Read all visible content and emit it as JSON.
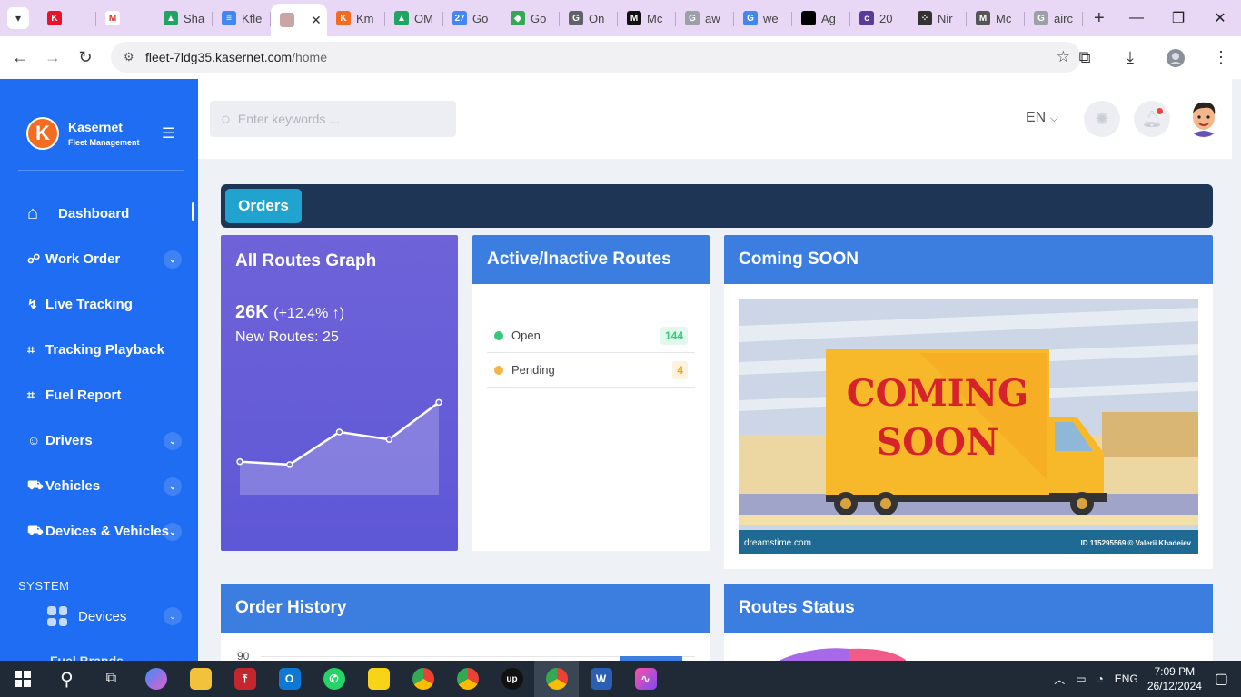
{
  "browser": {
    "tabs": [
      {
        "label": "",
        "fav_color": "#e8132b",
        "fav_text": "K"
      },
      {
        "label": "",
        "fav_color": "#ffffff",
        "fav_text": "M"
      },
      {
        "label": "Sha",
        "fav_color": "#1fa463",
        "fav_text": "▲"
      },
      {
        "label": "Kfle",
        "fav_color": "#4285f4",
        "fav_text": "≡"
      },
      {
        "label": "",
        "fav_color": "#c9a5a5",
        "fav_text": "",
        "active": true
      },
      {
        "label": "Km",
        "fav_color": "#f36c21",
        "fav_text": "K"
      },
      {
        "label": "OM",
        "fav_color": "#1fa463",
        "fav_text": "▲"
      },
      {
        "label": "Go",
        "fav_color": "#4285f4",
        "fav_text": "27"
      },
      {
        "label": "Go",
        "fav_color": "#34a853",
        "fav_text": "◆"
      },
      {
        "label": "On",
        "fav_color": "#5f6368",
        "fav_text": "G"
      },
      {
        "label": "Mc",
        "fav_color": "#111111",
        "fav_text": "M"
      },
      {
        "label": "aw",
        "fav_color": "#9aa0a6",
        "fav_text": "G"
      },
      {
        "label": "we",
        "fav_color": "#4285f4",
        "fav_text": "G"
      },
      {
        "label": "Ag",
        "fav_color": "#000000",
        "fav_text": ""
      },
      {
        "label": "20",
        "fav_color": "#5b3a99",
        "fav_text": "c"
      },
      {
        "label": "Nir",
        "fav_color": "#333333",
        "fav_text": "⁘"
      },
      {
        "label": "Mc",
        "fav_color": "#555555",
        "fav_text": "M"
      },
      {
        "label": "airc",
        "fav_color": "#9aa0a6",
        "fav_text": "G"
      }
    ],
    "url_host": "fleet-7ldg35.kasernet.com",
    "url_path": "/home"
  },
  "sidebar": {
    "brand_name": "Kasernet",
    "brand_sub": "Fleet Management",
    "brand_logo": "K",
    "items": [
      {
        "label": "Dashboard",
        "icon": "home-icon",
        "glyph": "⌂",
        "expandable": false,
        "active": true
      },
      {
        "label": "Work Order",
        "icon": "work-order-icon",
        "glyph": "☍",
        "expandable": true
      },
      {
        "label": "Live Tracking",
        "icon": "route-icon",
        "glyph": "↯",
        "expandable": false
      },
      {
        "label": "Tracking Playback",
        "icon": "playback-icon",
        "glyph": "⌗",
        "expandable": false
      },
      {
        "label": "Fuel Report",
        "icon": "fuel-report-icon",
        "glyph": "⌗",
        "expandable": false
      },
      {
        "label": "Drivers",
        "icon": "drivers-icon",
        "glyph": "☺",
        "expandable": true
      },
      {
        "label": "Vehicles",
        "icon": "vehicle-icon",
        "glyph": "⛟",
        "expandable": true
      },
      {
        "label": "Devices & Vehicles",
        "icon": "devices-vehicles-icon",
        "glyph": "⛟",
        "expandable": true
      }
    ],
    "system_label": "SYSTEM",
    "system_items": [
      {
        "label": "Devices",
        "icon": "grid-icon"
      }
    ],
    "cut_item": "Fuel Brands"
  },
  "header": {
    "search_placeholder": "Enter keywords ...",
    "language": "EN"
  },
  "toolbar": {
    "orders_label": "Orders"
  },
  "graph_card": {
    "title": "All Routes Graph",
    "value": "26K",
    "change": "(+12.4% ↑)",
    "sub": "New Routes: 25",
    "accent": "#6a60d9"
  },
  "chart_data": {
    "type": "area",
    "title": "All Routes Graph",
    "x": [
      1,
      2,
      3,
      4,
      5
    ],
    "series": [
      {
        "values": [
          10,
          8,
          30,
          25,
          50
        ]
      }
    ],
    "ylim": [
      0,
      60
    ],
    "grid": false
  },
  "routes_card": {
    "title": "Active/Inactive Routes",
    "rows": [
      {
        "label": "Open",
        "count": "144",
        "dot": "#34c97c",
        "badge_bg": "#e3f8ec",
        "badge_fg": "#34c97c"
      },
      {
        "label": "Pending",
        "count": "4",
        "dot": "#f5b544",
        "badge_bg": "#fdf2df",
        "badge_fg": "#f5a623"
      }
    ]
  },
  "soon_card": {
    "title": "Coming SOON",
    "line1": "COMING",
    "line2": "SOON",
    "credit_left": "dreamstime.com",
    "credit_right": "ID 115295569 © Valerii Khadeiev"
  },
  "history_card": {
    "title": "Order History",
    "y_tick": "90"
  },
  "status_card": {
    "title": "Routes Status"
  },
  "taskbar": {
    "lang": "ENG",
    "time": "7:09 PM",
    "date": "26/12/2024"
  }
}
